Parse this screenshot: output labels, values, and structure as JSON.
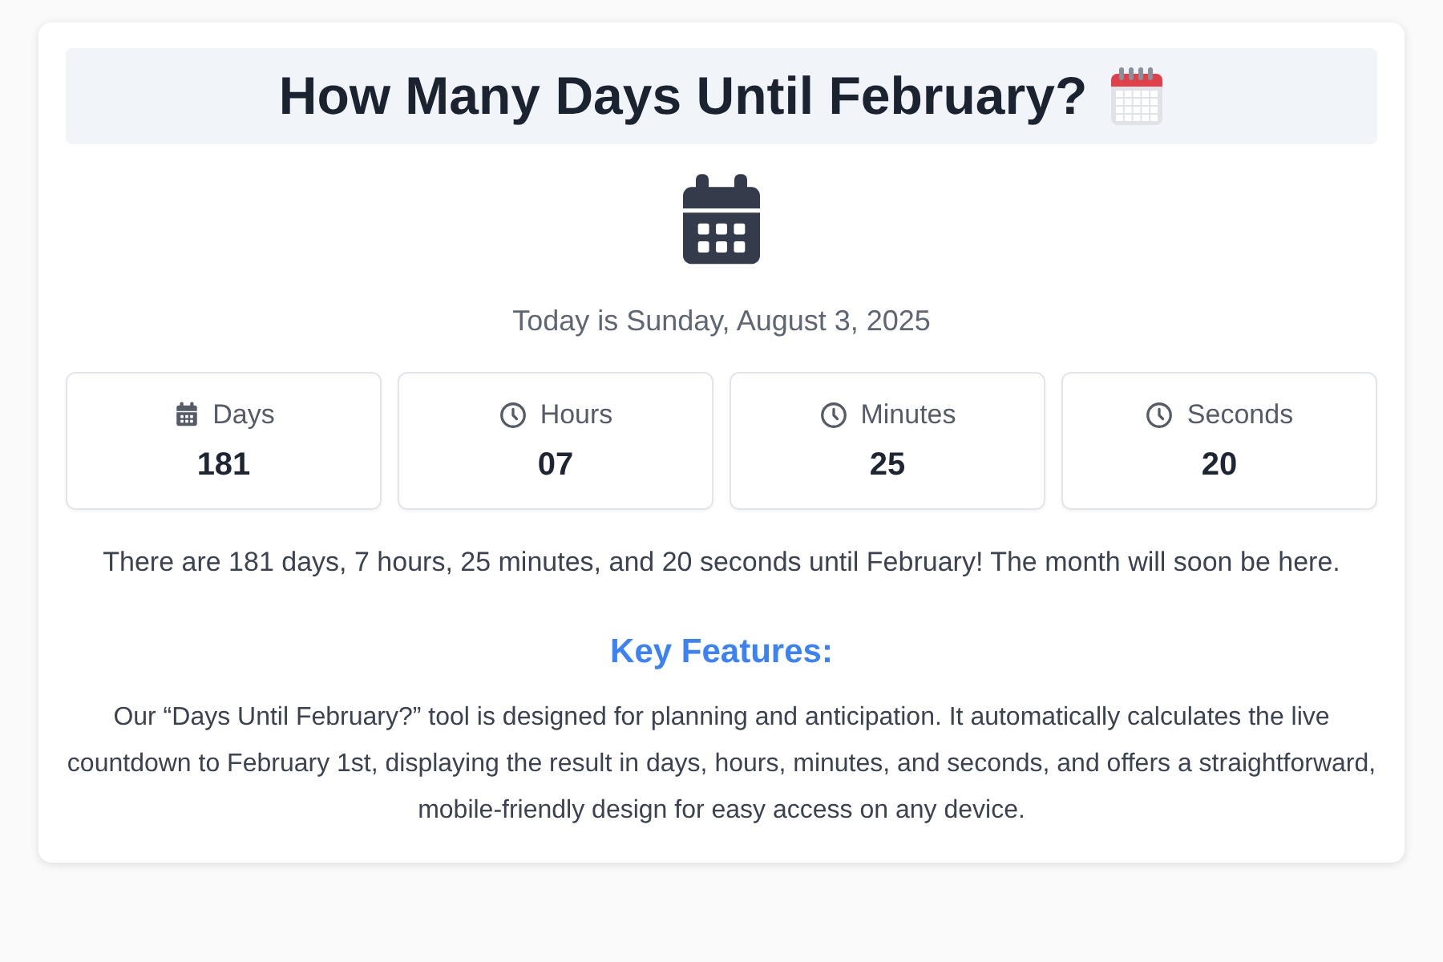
{
  "title": "How Many Days Until February?",
  "today": "Today is Sunday, August 3, 2025",
  "units": [
    {
      "kind": "calendar",
      "label": "Days",
      "value": "181"
    },
    {
      "kind": "clock",
      "label": "Hours",
      "value": "07"
    },
    {
      "kind": "clock",
      "label": "Minutes",
      "value": "25"
    },
    {
      "kind": "clock",
      "label": "Seconds",
      "value": "20"
    }
  ],
  "summary": "There are 181 days, 7 hours, 25 minutes, and 20 seconds until February! The month will soon be here.",
  "features_heading": "Key Features:",
  "features_text": "Our “Days Until February?” tool is designed for planning and anticipation. It automatically calculates the live countdown to February 1st, displaying the result in days, hours, minutes, and seconds, and offers a straightforward, mobile-friendly design for easy access on any device."
}
